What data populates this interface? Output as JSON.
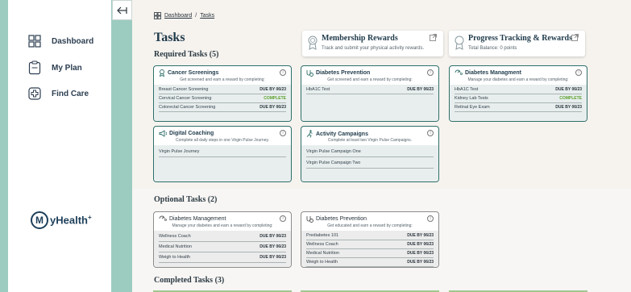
{
  "sidebar": {
    "items": [
      {
        "label": "Dashboard",
        "icon": "grid-icon"
      },
      {
        "label": "My Plan",
        "icon": "clipboard-icon"
      },
      {
        "label": "Find Care",
        "icon": "medical-cross-icon"
      }
    ],
    "logo": {
      "badge": "M",
      "text": "yHealth",
      "mark": "+"
    }
  },
  "breadcrumb": {
    "home": "Dashboard",
    "separator": "/",
    "current": "Tasks"
  },
  "page_title": "Tasks",
  "rewards": [
    {
      "title": "Membership Rewards",
      "subtitle": "Track and submit your physical activity rewards."
    },
    {
      "title": "Progress Tracking & Rewards",
      "subtitle": "Total Balance: 0 points"
    }
  ],
  "required": {
    "heading": "Required Tasks (5)",
    "cards": [
      {
        "title": "Cancer Screenings",
        "subtitle": "Get screened and earn a reward by completing:",
        "rows": [
          {
            "name": "Breast Cancer Screening",
            "status": "DUE BY 06/23",
            "complete": false
          },
          {
            "name": "Cervical Cancer Screening",
            "status": "COMPLETE",
            "complete": true
          },
          {
            "name": "Colorectal Cancer Screening",
            "status": "DUE BY 06/23",
            "complete": false
          }
        ]
      },
      {
        "title": "Diabetes Prevention",
        "subtitle": "Get screened and earn a reward by completing:",
        "rows": [
          {
            "name": "HbA1C Test",
            "status": "DUE BY 06/23",
            "complete": false
          }
        ]
      },
      {
        "title": "Diabetes Managment",
        "subtitle": "Manage your diabetes and earn a reward by completing:",
        "rows": [
          {
            "name": "HbA1C Test",
            "status": "DUE BY 06/23",
            "complete": false
          },
          {
            "name": "Kidney Lab Tests",
            "status": "COMPLETE",
            "complete": true
          },
          {
            "name": "Retinal Eye Exam",
            "status": "DUE BY 06/23",
            "complete": false
          }
        ]
      },
      {
        "title": "Digital Coaching",
        "subtitle": "Complete all daily steps in one Virgin Pulse Journey.",
        "rows": [
          {
            "name": "Virgin Pulse Journey",
            "status": "",
            "complete": false
          }
        ]
      },
      {
        "title": "Activity Campaigns",
        "subtitle": "Complete at least two Virgin Pulse Campaigns.",
        "rows": [
          {
            "name": "Virgin Pulse Campaign One",
            "status": "",
            "complete": false
          },
          {
            "name": "Virgin Pulse Campaign Two",
            "status": "",
            "complete": false
          }
        ]
      }
    ]
  },
  "optional": {
    "heading": "Optional Tasks (2)",
    "cards": [
      {
        "title": "Diabetes Management",
        "subtitle": "Manage your diabetes and earn a reward by completing:",
        "rows": [
          {
            "name": "Wellness Coach",
            "status": "DUE BY 06/23"
          },
          {
            "name": "Medical Nutrition",
            "status": "DUE BY 06/23"
          },
          {
            "name": "Weigh to Health",
            "status": "DUE BY 06/23"
          }
        ]
      },
      {
        "title": "Diabetes Prevention",
        "subtitle": "Get educated and earn a reward by completing:",
        "rows": [
          {
            "name": "Prediabetes 101",
            "status": "DUE BY 06/23"
          },
          {
            "name": "Wellness Coach",
            "status": "DUE BY 06/23"
          },
          {
            "name": "Medical Nutrition",
            "status": "DUE BY 06/23"
          },
          {
            "name": "Weigh to Health",
            "status": "DUE BY 06/23"
          }
        ]
      }
    ]
  },
  "completed": {
    "heading": "Completed Tasks (3)"
  },
  "colors": {
    "accent": "#2f6f6a",
    "complete": "#5aa02c",
    "background": "#9ccbc0"
  }
}
